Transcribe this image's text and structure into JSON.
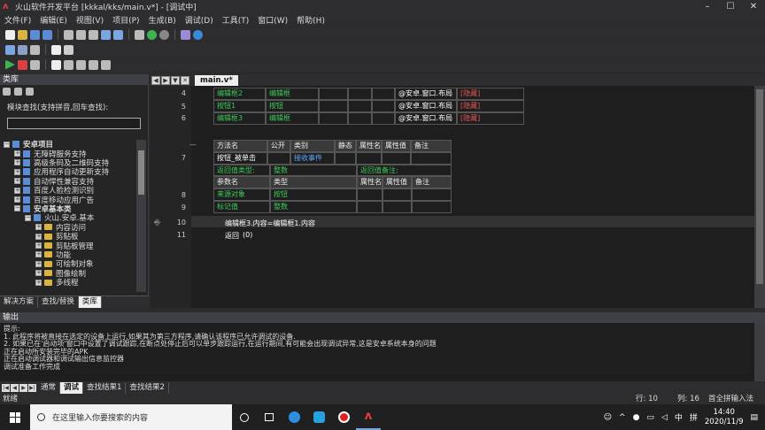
{
  "window": {
    "title": "火山软件开发平台 [kkkal/kks/main.v*] - [调试中]"
  },
  "menu": [
    "文件(F)",
    "编辑(E)",
    "视图(V)",
    "项目(P)",
    "生成(B)",
    "调试(D)",
    "工具(T)",
    "窗口(W)",
    "帮助(H)"
  ],
  "left_panel": {
    "title": "类库",
    "search_label": "模块查找(支持拼音,回车查找):",
    "tree": [
      {
        "label": "安卓项目",
        "indent": 0,
        "kind": "book",
        "bold": true
      },
      {
        "label": "无障碍服务支持",
        "indent": 1,
        "kind": "book"
      },
      {
        "label": "高级条码及二维码支持",
        "indent": 1,
        "kind": "book"
      },
      {
        "label": "应用程序自动更新支持",
        "indent": 1,
        "kind": "book"
      },
      {
        "label": "自动悍性兼容支持",
        "indent": 1,
        "kind": "book"
      },
      {
        "label": "百度人脸检测识别",
        "indent": 1,
        "kind": "book"
      },
      {
        "label": "百度移动应用广告",
        "indent": 1,
        "kind": "book"
      },
      {
        "label": "安卓基本类",
        "indent": 1,
        "kind": "book",
        "bold": true
      },
      {
        "label": "火山.安卓.基本",
        "indent": 2,
        "kind": "book"
      },
      {
        "label": "内容访问",
        "indent": 3,
        "kind": "folder"
      },
      {
        "label": "剪贴板",
        "indent": 3,
        "kind": "folder"
      },
      {
        "label": "剪贴板管理",
        "indent": 3,
        "kind": "folder"
      },
      {
        "label": "功能",
        "indent": 3,
        "kind": "folder"
      },
      {
        "label": "可绘制对象",
        "indent": 3,
        "kind": "folder"
      },
      {
        "label": "图像绘制",
        "indent": 3,
        "kind": "folder"
      },
      {
        "label": "多线程",
        "indent": 3,
        "kind": "folder"
      }
    ],
    "tabs": [
      "解决方案",
      "查找/替换",
      "类库"
    ]
  },
  "editor": {
    "tab": "main.v*",
    "lines": {
      "l4": "4",
      "l5": "5",
      "l6": "6",
      "l7": "7",
      "l8": "8",
      "l9": "9",
      "l10": "10",
      "l11": "11"
    },
    "table1": [
      [
        "编辑框2",
        "编辑框",
        "",
        "",
        "",
        "",
        "@安卓.窗口.布局",
        "[隐藏]"
      ],
      [
        "按钮1",
        "按钮",
        "",
        "",
        "",
        "",
        "@安卓.窗口.布局",
        "[隐藏]"
      ],
      [
        "编辑框3",
        "编辑框",
        "",
        "",
        "",
        "",
        "@安卓.窗口.布局",
        "[隐藏]"
      ]
    ],
    "method_header": [
      "方法名",
      "公开",
      "类别",
      "静态",
      "属性名",
      "属性值",
      "备注"
    ],
    "method_row": [
      "按钮_被单击",
      "",
      "接收事件",
      "",
      "",
      "",
      ""
    ],
    "return_row": {
      "label": "返回值类型:",
      "value": "整数",
      "attr_label": "返回值备注:"
    },
    "param_header": [
      "参数名",
      "类型",
      "属性名",
      "属性值",
      "备注"
    ],
    "params": [
      [
        "来源对象",
        "按钮"
      ],
      [
        "标记值",
        "整数"
      ]
    ],
    "code10": "编辑框3.内容=编辑框1.内容",
    "code11": {
      "kw": "返回",
      "val": "(0)"
    }
  },
  "output": {
    "title": "输出",
    "lines": [
      "提示:",
      "  1. 此程序将被直接在选定的设备上运行,如果其为第三方程序,请确认该程序已允许调试的设备.",
      "  2. 如果已在'启动项'窗口中设置了调试跟踪,在断点处停止后可以单步跟踪运行,在运行期间,有可能会出现调试异常,这是安卓系统本身的问题",
      "正在启动所安装完毕的APK",
      "正在启动调试器和调试输出信息监控器",
      "调试准备工作完成"
    ],
    "tabs": [
      "通常",
      "调试",
      "查找结果1",
      "查找结果2"
    ]
  },
  "status": {
    "left": "就绪",
    "line": "行: 10",
    "col": "列: 16",
    "ime": "首全拼输入法"
  },
  "taskbar": {
    "search_placeholder": "在这里输入你要搜索的内容",
    "time": "14:40",
    "date": "2020/11/9",
    "lang": "中"
  }
}
